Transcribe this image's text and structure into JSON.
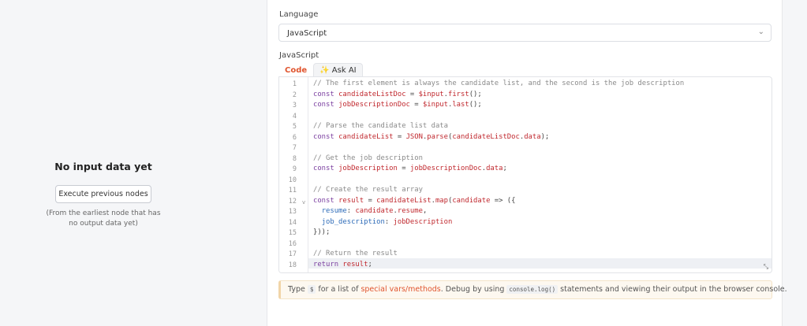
{
  "left": {
    "title": "No input data yet",
    "button": "Execute previous nodes",
    "hint_line1": "(From the earliest node that has",
    "hint_line2": "no output data yet)"
  },
  "language": {
    "label": "Language",
    "value": "JavaScript"
  },
  "editor": {
    "label": "JavaScript",
    "tabs": [
      "Code",
      "Ask AI"
    ],
    "lines": [
      [
        [
          "c",
          "// The first element is always the candidate list, and the second is the job description"
        ]
      ],
      [
        [
          "k",
          "const "
        ],
        [
          "v",
          "candidateListDoc"
        ],
        [
          "o",
          " = "
        ],
        [
          "v",
          "$input"
        ],
        [
          "o",
          "."
        ],
        [
          "v",
          "first"
        ],
        [
          "o",
          "();"
        ]
      ],
      [
        [
          "k",
          "const "
        ],
        [
          "v",
          "jobDescriptionDoc"
        ],
        [
          "o",
          " = "
        ],
        [
          "v",
          "$input"
        ],
        [
          "o",
          "."
        ],
        [
          "v",
          "last"
        ],
        [
          "o",
          "();"
        ]
      ],
      [],
      [
        [
          "c",
          "// Parse the candidate list data"
        ]
      ],
      [
        [
          "k",
          "const "
        ],
        [
          "v",
          "candidateList"
        ],
        [
          "o",
          " = "
        ],
        [
          "v",
          "JSON"
        ],
        [
          "o",
          "."
        ],
        [
          "v",
          "parse"
        ],
        [
          "o",
          "("
        ],
        [
          "v",
          "candidateListDoc"
        ],
        [
          "o",
          "."
        ],
        [
          "v",
          "data"
        ],
        [
          "o",
          ");"
        ]
      ],
      [],
      [
        [
          "c",
          "// Get the job description"
        ]
      ],
      [
        [
          "k",
          "const "
        ],
        [
          "v",
          "jobDescription"
        ],
        [
          "o",
          " = "
        ],
        [
          "v",
          "jobDescriptionDoc"
        ],
        [
          "o",
          "."
        ],
        [
          "v",
          "data"
        ],
        [
          "o",
          ";"
        ]
      ],
      [],
      [
        [
          "c",
          "// Create the result array"
        ]
      ],
      [
        [
          "k",
          "const "
        ],
        [
          "v",
          "result"
        ],
        [
          "o",
          " = "
        ],
        [
          "v",
          "candidateList"
        ],
        [
          "o",
          "."
        ],
        [
          "v",
          "map"
        ],
        [
          "o",
          "("
        ],
        [
          "v",
          "candidate"
        ],
        [
          "o",
          " => ({"
        ]
      ],
      [
        [
          "o",
          "  "
        ],
        [
          "p",
          "resume"
        ],
        [
          "o",
          ": "
        ],
        [
          "v",
          "candidate"
        ],
        [
          "o",
          "."
        ],
        [
          "v",
          "resume"
        ],
        [
          "o",
          ","
        ]
      ],
      [
        [
          "o",
          "  "
        ],
        [
          "p",
          "job_description"
        ],
        [
          "o",
          ": "
        ],
        [
          "v",
          "jobDescription"
        ]
      ],
      [
        [
          "o",
          "}));"
        ]
      ],
      [],
      [
        [
          "c",
          "// Return the result"
        ]
      ],
      [
        [
          "k",
          "return "
        ],
        [
          "v",
          "result"
        ],
        [
          "o",
          ";"
        ]
      ]
    ]
  },
  "notice": {
    "t1": "Type ",
    "kbd1": "$",
    "t2": " for a list of ",
    "link": "special vars/methods",
    "t3": ". Debug by using ",
    "kbd2": "console.log()",
    "t4": " statements and viewing their output in the browser console."
  }
}
